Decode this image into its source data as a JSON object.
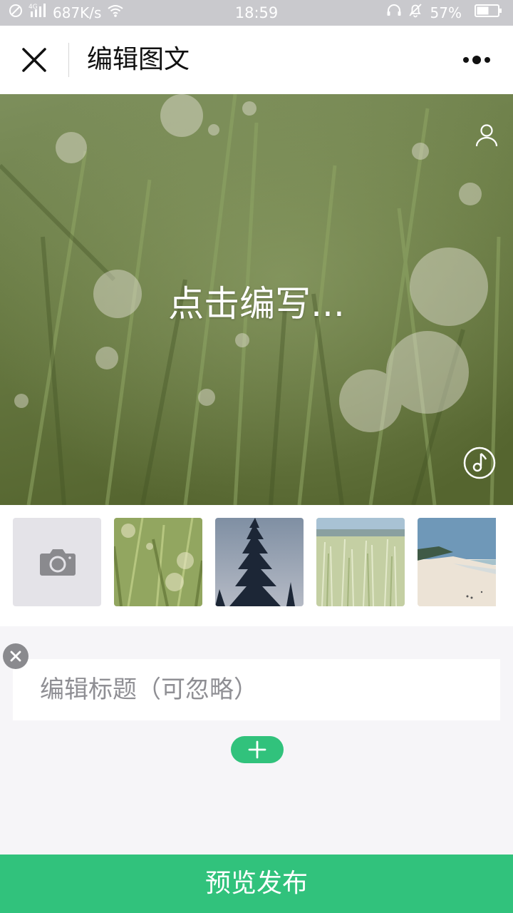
{
  "status_bar": {
    "network_type": "4G",
    "speed": "687K/s",
    "time": "18:59",
    "battery_percent": "57%",
    "battery_level": 0.57,
    "icons": [
      "no-disturb-icon",
      "signal-icon",
      "wifi-icon",
      "headset-icon",
      "bell-muted-icon",
      "battery-icon"
    ]
  },
  "nav": {
    "title": "编辑图文",
    "close_icon": "close-icon",
    "more_icon": "more-dots-icon"
  },
  "cover": {
    "prompt": "点击编写...",
    "user_icon": "user-icon",
    "music_icon": "music-note-icon"
  },
  "thumbnails": {
    "camera_icon": "camera-icon",
    "images": [
      "grass-bokeh",
      "pine-tree",
      "wheat-field",
      "beach"
    ]
  },
  "editor": {
    "title_placeholder": "编辑标题（可忽略）",
    "clear_icon": "clear-icon",
    "add_icon": "plus-icon"
  },
  "footer": {
    "publish_label": "预览发布"
  },
  "colors": {
    "accent": "#31c27c",
    "status_bar": "#c9c9cd",
    "background": "#f6f5f8"
  }
}
